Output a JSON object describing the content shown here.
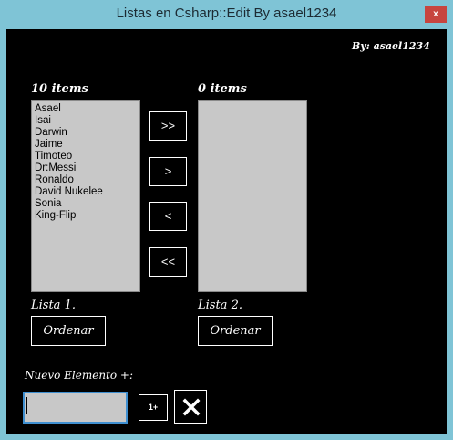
{
  "window": {
    "title": "Listas en Csharp::Edit By asael1234",
    "close_label": "x"
  },
  "author": "By: asael1234",
  "list1": {
    "count_label": "10 items",
    "items": [
      "Asael",
      "Isai",
      "Darwin",
      "Jaime",
      "Timoteo",
      "Dr:Messi",
      "Ronaldo",
      "David Nukelee",
      "Sonia",
      "King-Flip"
    ],
    "caption": "Lista 1.",
    "sort_label": "Ordenar"
  },
  "list2": {
    "count_label": "0 items",
    "items": [],
    "caption": "Lista 2.",
    "sort_label": "Ordenar"
  },
  "move_buttons": {
    "all_right": ">>",
    "one_right": ">",
    "one_left": "<",
    "all_left": "<<"
  },
  "new_item": {
    "label": "Nuevo Elemento +:",
    "value": "",
    "add_label": "1+",
    "delete_icon": "x-mark-icon"
  },
  "colors": {
    "background": "#000000",
    "window_chrome": "#7fc4d6",
    "close_button": "#c7453f",
    "listbox": "#c8c8c8",
    "input_focus_border": "#3f8fd0"
  }
}
